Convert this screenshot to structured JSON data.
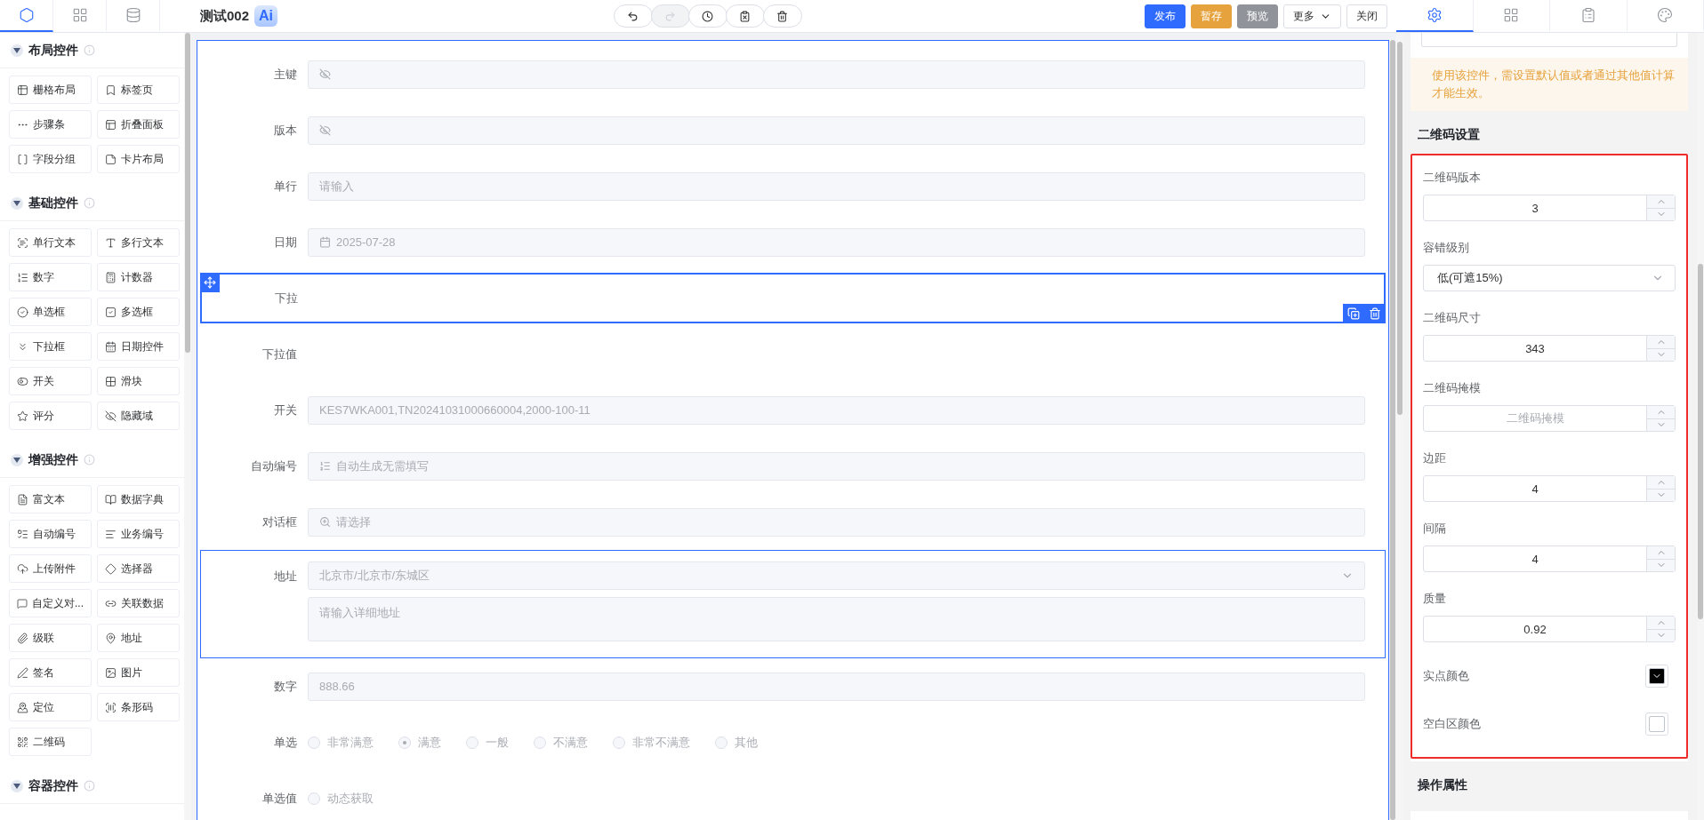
{
  "left_panel": {
    "tabs": [
      {
        "selected": true
      },
      {
        "selected": false
      },
      {
        "selected": false
      }
    ],
    "groups": [
      {
        "title": "布局控件",
        "expanded": true,
        "items": [
          "栅格布局",
          "标签页",
          "步骤条",
          "折叠面板",
          "字段分组",
          "卡片布局"
        ]
      },
      {
        "title": "基础控件",
        "expanded": true,
        "items": [
          "单行文本",
          "多行文本",
          "数字",
          "计数器",
          "单选框",
          "多选框",
          "下拉框",
          "日期控件",
          "开关",
          "滑块",
          "评分",
          "隐藏域"
        ]
      },
      {
        "title": "增强控件",
        "expanded": true,
        "items": [
          "富文本",
          "数据字典",
          "自动编号",
          "业务编号",
          "上传附件",
          "选择器",
          "自定义对...",
          "关联数据",
          "级联",
          "地址",
          "签名",
          "图片",
          "定位",
          "条形码",
          "二维码"
        ]
      },
      {
        "title": "容器控件",
        "expanded": true
      }
    ]
  },
  "toolbar": {
    "title": "测试002",
    "ai_badge": "Ai",
    "history_buttons": [
      {
        "disabled": false
      },
      {
        "disabled": true
      },
      {
        "disabled": false
      },
      {
        "disabled": false
      },
      {
        "disabled": false
      }
    ],
    "actions": [
      {
        "label": "发布",
        "kind": "primary"
      },
      {
        "label": "暂存",
        "kind": "warning"
      },
      {
        "label": "预览",
        "kind": "info"
      },
      {
        "label": "更多",
        "kind": "dropdown"
      },
      {
        "label": "关闭",
        "kind": "plain"
      }
    ]
  },
  "form": {
    "rows": [
      {
        "label": "主键",
        "kind": "hidden",
        "selected": false,
        "hovered": false
      },
      {
        "label": "版本",
        "kind": "hidden",
        "selected": false,
        "hovered": false
      },
      {
        "label": "单行",
        "kind": "text",
        "placeholder": "请输入",
        "selected": false,
        "hovered": false
      },
      {
        "label": "日期",
        "kind": "date",
        "value": "2025-07-28",
        "selected": false,
        "hovered": false
      },
      {
        "label": "下拉",
        "kind": "empty",
        "selected": true,
        "hovered": false
      },
      {
        "label": "下拉值",
        "kind": "empty",
        "selected": false,
        "hovered": false
      },
      {
        "label": "开关",
        "kind": "text",
        "value": "KES7WKA001,TN20241031000660004,2000-100-11",
        "selected": false,
        "hovered": false
      },
      {
        "label": "自动编号",
        "kind": "autonumber",
        "value": "自动生成无需填写",
        "selected": false,
        "hovered": false
      },
      {
        "label": "对话框",
        "kind": "dialog",
        "placeholder": "请选择",
        "selected": false,
        "hovered": false
      },
      {
        "label": "地址",
        "kind": "address",
        "value": "北京市/北京市/东城区",
        "detail_placeholder": "请输入详细地址",
        "selected": false,
        "hovered": true
      },
      {
        "label": "数字",
        "kind": "text",
        "value": "888.66",
        "selected": false,
        "hovered": false
      },
      {
        "label": "单选",
        "kind": "radio",
        "options": [
          {
            "label": "非常满意",
            "selected": false
          },
          {
            "label": "满意",
            "selected": true
          },
          {
            "label": "一般",
            "selected": false
          },
          {
            "label": "不满意",
            "selected": false
          },
          {
            "label": "非常不满意",
            "selected": false
          },
          {
            "label": "其他",
            "selected": false
          }
        ],
        "selected": false,
        "hovered": false
      },
      {
        "label": "单选值",
        "kind": "radio",
        "options": [
          {
            "label": "动态获取",
            "selected": false
          }
        ],
        "selected": false,
        "hovered": false
      }
    ]
  },
  "right_panel": {
    "tabs": [
      {
        "selected": true
      },
      {
        "selected": false
      },
      {
        "selected": false
      },
      {
        "selected": false
      }
    ],
    "notice": "使用该控件，需设置默认值或者通过其他值计算才能生效。",
    "section_title": "二维码设置",
    "settings": [
      {
        "label": "二维码版本",
        "kind": "number",
        "value": "3"
      },
      {
        "label": "容错级别",
        "kind": "select",
        "value": "低(可遮15%)"
      },
      {
        "label": "二维码尺寸",
        "kind": "number",
        "value": "343"
      },
      {
        "label": "二维码掩模",
        "kind": "number",
        "placeholder": "二维码掩模"
      },
      {
        "label": "边距",
        "kind": "number",
        "value": "4"
      },
      {
        "label": "间隔",
        "kind": "number",
        "value": "4"
      },
      {
        "label": "质量",
        "kind": "number",
        "value": "0.92"
      },
      {
        "label": "实点颜色",
        "kind": "color",
        "color": "#000000",
        "dropdown": true
      },
      {
        "label": "空白区颜色",
        "kind": "color",
        "color": "#ffffff",
        "dropdown": false
      }
    ],
    "next_section_title": "操作属性"
  }
}
